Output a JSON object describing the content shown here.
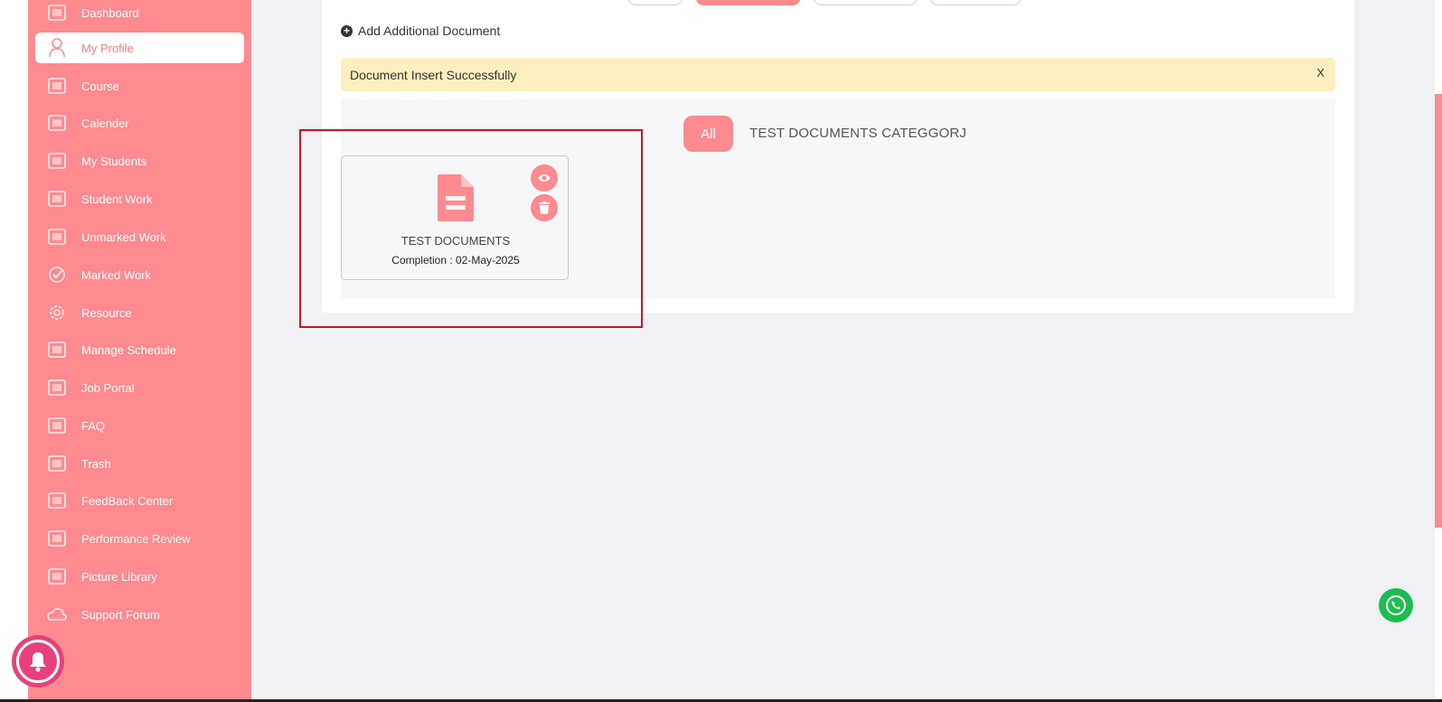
{
  "sidebar": {
    "items": [
      {
        "label": "Dashboard",
        "icon": "dashboard-icon",
        "active": false
      },
      {
        "label": "My Profile",
        "icon": "user-icon",
        "active": true
      },
      {
        "label": "Course",
        "icon": "course-icon",
        "active": false
      },
      {
        "label": "Calender",
        "icon": "calendar-icon",
        "active": false
      },
      {
        "label": "My Students",
        "icon": "student-icon",
        "active": false
      },
      {
        "label": "Student Work",
        "icon": "monitor-icon",
        "active": false
      },
      {
        "label": "Unmarked Work",
        "icon": "unmarked-icon",
        "active": false
      },
      {
        "label": "Marked Work",
        "icon": "check-icon",
        "active": false
      },
      {
        "label": "Resource",
        "icon": "gear-icon",
        "active": false
      },
      {
        "label": "Manage Schedule",
        "icon": "schedule-icon",
        "active": false
      },
      {
        "label": "Job Portal",
        "icon": "briefcase-icon",
        "active": false
      },
      {
        "label": "FAQ",
        "icon": "video-icon",
        "active": false
      },
      {
        "label": "Trash",
        "icon": "trash-icon",
        "active": false
      },
      {
        "label": "FeedBack Center",
        "icon": "feedback-icon",
        "active": false
      },
      {
        "label": "Performance Review",
        "icon": "performance-icon",
        "active": false
      },
      {
        "label": "Picture Library",
        "icon": "camera-icon",
        "active": false
      },
      {
        "label": "Support Forum",
        "icon": "cloud-icon",
        "active": false
      }
    ]
  },
  "main": {
    "add_document_label": "Add Additional Document",
    "alert": {
      "message": "Document Insert Successfully",
      "close_label": "X"
    },
    "filters": {
      "all_label": "All",
      "category_label": "TEST DOCUMENTS CATEGGORJ"
    },
    "document": {
      "title": "TEST DOCUMENTS",
      "completion": "Completion : 02-May-2025"
    }
  },
  "colors": {
    "brand_pink": "#ff8a8f",
    "alert_bg": "#fcefbf",
    "highlight_red": "#d0101f",
    "whatsapp_green": "#1ebd4f",
    "bell_pink": "#e8407a"
  }
}
